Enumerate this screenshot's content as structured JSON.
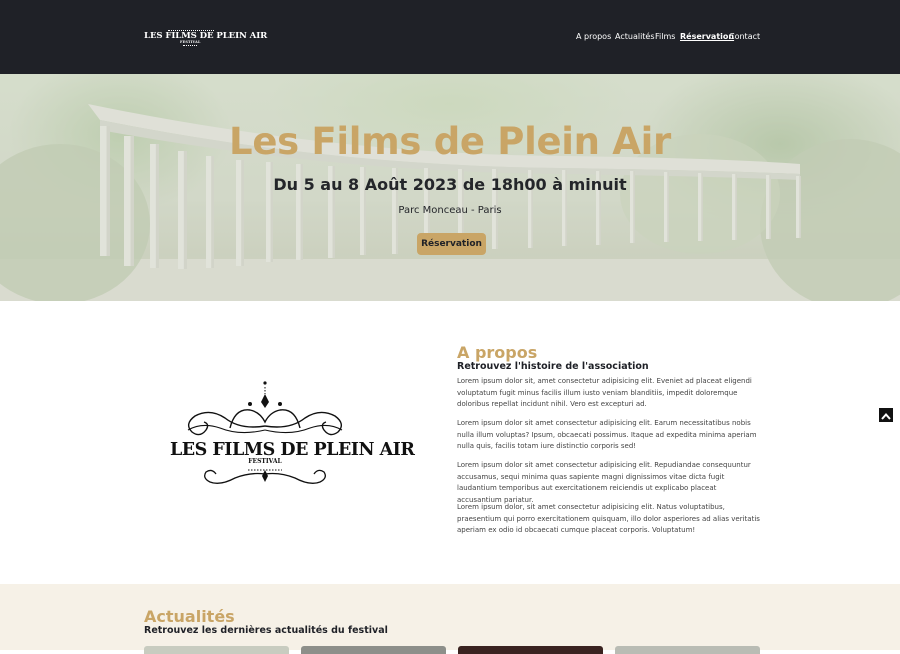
{
  "header": {
    "logo_text": "LES FILMS DE PLEIN AIR",
    "logo_sub": "FESTIVAL",
    "nav": [
      "A propos",
      "Actualités",
      "Films",
      "Réservation",
      "Contact"
    ],
    "active_nav": "Réservation"
  },
  "hero": {
    "title": "Les Films de Plein Air",
    "date": "Du 5 au 8 Août 2023 de 18h00 à minuit",
    "place": "Parc Monceau - Paris",
    "button": "Réservation"
  },
  "about": {
    "logo_text": "LES FILMS DE PLEIN AIR",
    "logo_sub": "FESTIVAL",
    "title": "A propos",
    "subtitle": "Retrouvez l'histoire de l'association",
    "paragraphs": [
      "Lorem ipsum dolor sit, amet consectetur adipisicing elit. Eveniet ad placeat eligendi voluptatum fugit minus facilis illum iusto veniam blanditiis, impedit doloremque doloribus repellat incidunt nihil. Vero est excepturi ad.",
      "Lorem ipsum dolor sit amet consectetur adipisicing elit. Earum necessitatibus nobis nulla illum voluptas? Ipsum, obcaecati possimus. Itaque ad expedita minima aperiam nulla quis, facilis totam iure distinctio corporis sed!",
      "Lorem ipsum dolor sit amet consectetur adipisicing elit. Repudiandae consequuntur accusamus, sequi minima quas sapiente magni dignissimos vitae dicta fugit laudantium temporibus aut exercitationem reiciendis ut explicabo placeat accusantium pariatur.",
      "Lorem ipsum dolor, sit amet consectetur adipisicing elit. Natus voluptatibus, praesentium qui porro exercitationem quisquam, illo dolor asperiores ad alias veritatis aperiam ex odio id obcaecati cumque placeat corporis. Voluptatum!"
    ]
  },
  "news": {
    "title": "Actualités",
    "subtitle": "Retrouvez les dernières actualités du festival"
  },
  "colors": {
    "gold": "#c9a566",
    "dark": "#1f2127",
    "news_bg": "#f6f1e7"
  },
  "icons": {
    "to_top": "chevron-up-icon"
  }
}
